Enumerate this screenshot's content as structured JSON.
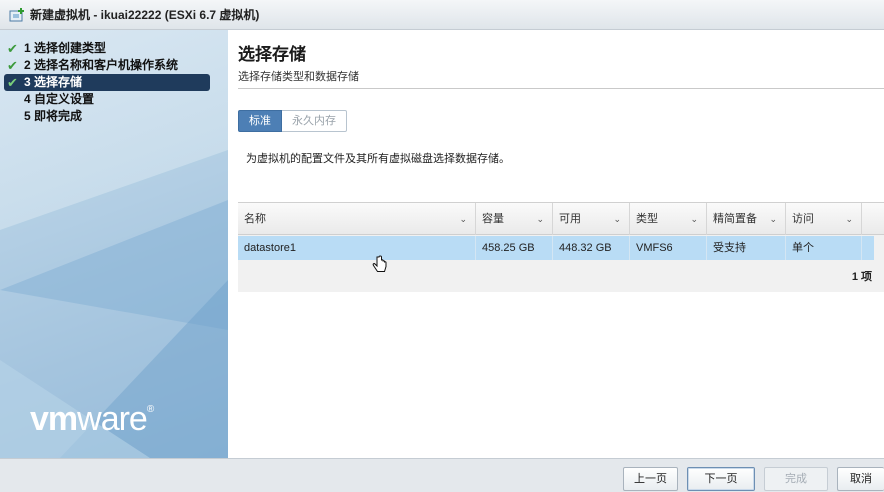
{
  "window": {
    "title": "新建虚拟机 - ikuai22222 (ESXi 6.7 虚拟机)"
  },
  "sidebar": {
    "steps": [
      {
        "label": "1 选择创建类型",
        "done": true
      },
      {
        "label": "2 选择名称和客户机操作系统",
        "done": true
      },
      {
        "label": "3 选择存储",
        "done": true,
        "active": true
      },
      {
        "label": "4 自定义设置",
        "done": false
      },
      {
        "label": "5 即将完成",
        "done": false
      }
    ],
    "check_glyph": "✔",
    "logo_bold": "vm",
    "logo_rest": "ware",
    "logo_mark": "®"
  },
  "main": {
    "title": "选择存储",
    "subtitle": "选择存储类型和数据存储",
    "tabs": [
      "标准",
      "永久内存"
    ],
    "description": "为虚拟机的配置文件及其所有虚拟磁盘选择数据存储。",
    "grid": {
      "columns": [
        "名称",
        "容量",
        "可用",
        "类型",
        "精简置备",
        "访问"
      ],
      "rows": [
        [
          "datastore1",
          "458.25 GB",
          "448.32 GB",
          "VMFS6",
          "受支持",
          "单个"
        ]
      ],
      "footer": "1 项",
      "chevron": "⌄"
    }
  },
  "footer": {
    "prev": "上一页",
    "next": "下一页",
    "finish": "完成",
    "cancel": "取消"
  },
  "colors": {
    "selected_row": "#b9dcf5",
    "active_step": "#1f3b5c",
    "tab_on": "#4d7fb5",
    "check": "#3c9a3c"
  },
  "icons": {
    "window": "vm-create-icon",
    "cursor": "hand-pointer-icon",
    "check": "check-icon",
    "sort": "chevron-down-icon"
  }
}
